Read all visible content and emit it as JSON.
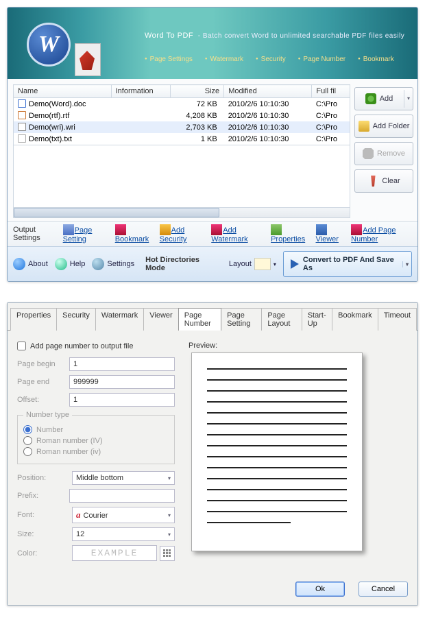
{
  "banner": {
    "title": "Word To PDF",
    "subtitle": "- Batch convert Word to unlimited searchable PDF files easily",
    "tabs": [
      "Page Settings",
      "Watermark",
      "Security",
      "Page Number",
      "Bookmark"
    ]
  },
  "file_table": {
    "columns": [
      "Name",
      "Information",
      "Size",
      "Modified",
      "Full fil"
    ],
    "rows": [
      {
        "icon": "doc",
        "name": "Demo(Word).doc",
        "info": "",
        "size": "72 KB",
        "modified": "2010/2/6 10:10:30",
        "path": "C:\\Pro"
      },
      {
        "icon": "rtf",
        "name": "Demo(rtf).rtf",
        "info": "",
        "size": "4,208 KB",
        "modified": "2010/2/6 10:10:30",
        "path": "C:\\Pro"
      },
      {
        "icon": "wri",
        "name": "Demo(wri).wri",
        "info": "",
        "size": "2,703 KB",
        "modified": "2010/2/6 10:10:30",
        "path": "C:\\Pro",
        "selected": true
      },
      {
        "icon": "txt",
        "name": "Demo(txt).txt",
        "info": "",
        "size": "1 KB",
        "modified": "2010/2/6 10:10:30",
        "path": "C:\\Pro"
      }
    ]
  },
  "side_buttons": {
    "add": "Add",
    "add_folder": "Add Folder",
    "remove": "Remove",
    "clear": "Clear"
  },
  "toolbar1": {
    "label": "Output Settings",
    "links": {
      "page_setting": "Page Setting",
      "bookmark": "Bookmark",
      "add_security": "Add Security",
      "add_watermark": "Add Watermark",
      "properties": "Properties",
      "viewer": "Viewer",
      "add_page_number": "Add Page Number"
    }
  },
  "toolbar2": {
    "about": "About",
    "help": "Help",
    "settings": "Settings",
    "hot_mode": "Hot Directories Mode",
    "layout": "Layout",
    "convert": "Convert to PDF And Save As"
  },
  "dialog": {
    "tabs": [
      "Properties",
      "Security",
      "Watermark",
      "Viewer",
      "Page Number",
      "Page Setting",
      "Page Layout",
      "Start-Up",
      "Bookmark",
      "Timeout"
    ],
    "active_tab": "Page Number",
    "checkbox_label": "Add page number to output file",
    "fields": {
      "page_begin_label": "Page begin",
      "page_begin": "1",
      "page_end_label": "Page end",
      "page_end": "999999",
      "offset_label": "Offset:",
      "offset": "1",
      "number_type_legend": "Number type",
      "radio_number": "Number",
      "radio_roman_upper": "Roman number (IV)",
      "radio_roman_lower": "Roman number (iv)",
      "position_label": "Position:",
      "position": "Middle bottom",
      "prefix_label": "Prefix:",
      "prefix": "",
      "font_label": "Font:",
      "font": "Courier",
      "size_label": "Size:",
      "size": "12",
      "color_label": "Color:",
      "example": "EXAMPLE"
    },
    "preview_label": "Preview:",
    "ok": "Ok",
    "cancel": "Cancel"
  }
}
